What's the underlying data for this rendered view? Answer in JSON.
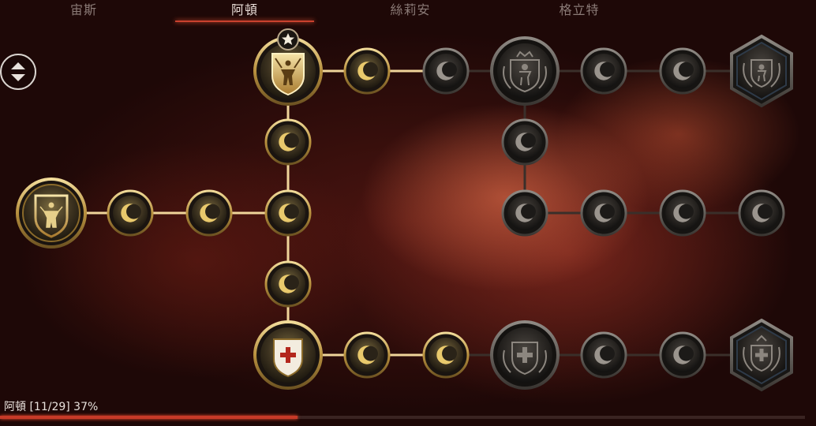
{
  "tabs": [
    {
      "label": "宙斯",
      "active": false
    },
    {
      "label": "阿頓",
      "active": true
    },
    {
      "label": "絲莉安",
      "active": false
    },
    {
      "label": "格立特",
      "active": false
    }
  ],
  "progress": {
    "label": "阿頓 [11/29] 37%",
    "fraction": 0.37
  },
  "colors": {
    "accent": "#c9412e",
    "gold": "#d8b25a",
    "line": "#e6c98f"
  },
  "icons": {
    "scroll": "up-down-arrows-icon",
    "small_node": "crescent-moon-icon",
    "warrior": "warrior-shield-emblem-icon",
    "healer": "medical-cross-shield-icon",
    "star": "star-icon"
  }
}
